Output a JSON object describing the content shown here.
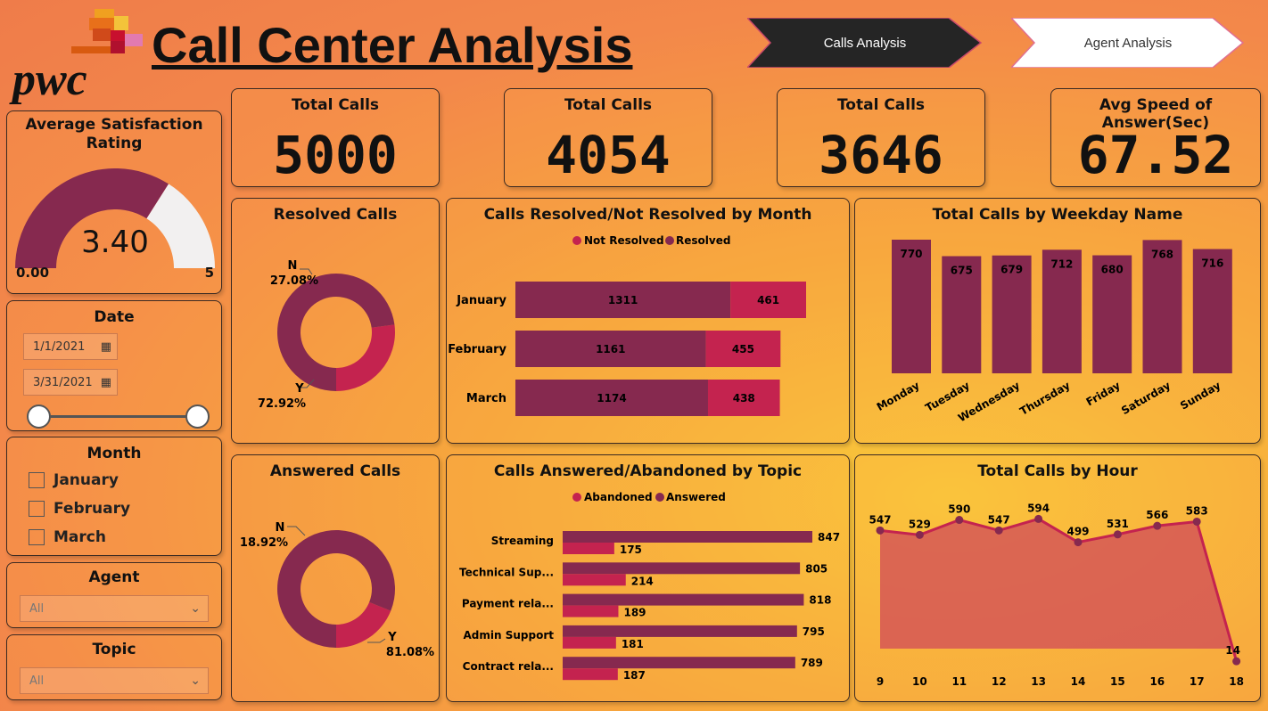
{
  "header": {
    "title": "Call Center Analysis",
    "logo_text": "pwc",
    "nav": [
      {
        "label": "Calls Analysis",
        "active": true
      },
      {
        "label": "Agent Analysis",
        "active": false
      }
    ]
  },
  "kpis": [
    {
      "title": "Total Calls",
      "value": "5000"
    },
    {
      "title": "Total Calls",
      "value": "4054"
    },
    {
      "title": "Total Calls",
      "value": "3646"
    },
    {
      "title": "Avg Speed of Answer(Sec)",
      "value": "67.52"
    }
  ],
  "satisfaction": {
    "title": "Average Satisfaction Rating",
    "value": "3.40",
    "min_label": "0.00",
    "max_label": "5",
    "fraction": 0.68
  },
  "date_slicer": {
    "title": "Date",
    "start": "1/1/2021",
    "end": "3/31/2021"
  },
  "month_slicer": {
    "title": "Month",
    "items": [
      "January",
      "February",
      "March"
    ]
  },
  "agent_slicer": {
    "title": "Agent",
    "value": "All"
  },
  "topic_slicer": {
    "title": "Topic",
    "value": "All"
  },
  "colors": {
    "primary": "#86294f",
    "secondary": "#c4234f",
    "gauge_bg": "#f2f0f0"
  },
  "chart_data": [
    {
      "type": "pie",
      "title": "Resolved Calls",
      "categories": [
        "N",
        "Y"
      ],
      "values": [
        27.08,
        72.92
      ],
      "labels": [
        "27.08%",
        "72.92%"
      ]
    },
    {
      "type": "pie",
      "title": "Answered Calls",
      "categories": [
        "N",
        "Y"
      ],
      "values": [
        18.92,
        81.08
      ],
      "labels": [
        "18.92%",
        "81.08%"
      ]
    },
    {
      "type": "bar",
      "orientation": "horizontal-stacked",
      "title": "Calls Resolved/Not Resolved by Month",
      "categories": [
        "January",
        "February",
        "March"
      ],
      "series": [
        {
          "name": "Resolved",
          "values": [
            1311,
            1161,
            1174
          ]
        },
        {
          "name": "Not Resolved",
          "values": [
            461,
            455,
            438
          ]
        }
      ],
      "legend": [
        "Not Resolved",
        "Resolved"
      ],
      "legend_position": "top"
    },
    {
      "type": "bar",
      "title": "Total Calls by Weekday Name",
      "categories": [
        "Monday",
        "Tuesday",
        "Wednesday",
        "Thursday",
        "Friday",
        "Saturday",
        "Sunday"
      ],
      "values": [
        770,
        675,
        679,
        712,
        680,
        768,
        716
      ]
    },
    {
      "type": "bar",
      "orientation": "horizontal-clustered",
      "title": "Calls Answered/Abandoned by Topic",
      "categories": [
        "Streaming",
        "Technical Sup...",
        "Payment rela...",
        "Admin Support",
        "Contract rela..."
      ],
      "series": [
        {
          "name": "Answered",
          "values": [
            847,
            805,
            818,
            795,
            789
          ]
        },
        {
          "name": "Abandoned",
          "values": [
            175,
            214,
            189,
            181,
            187
          ]
        }
      ],
      "legend": [
        "Abandoned",
        "Answered"
      ],
      "legend_position": "top"
    },
    {
      "type": "area",
      "title": "Total Calls by Hour",
      "x": [
        "9",
        "10",
        "11",
        "12",
        "13",
        "14",
        "15",
        "16",
        "17",
        "18"
      ],
      "values": [
        547,
        529,
        590,
        547,
        594,
        499,
        531,
        566,
        583,
        14
      ]
    }
  ]
}
